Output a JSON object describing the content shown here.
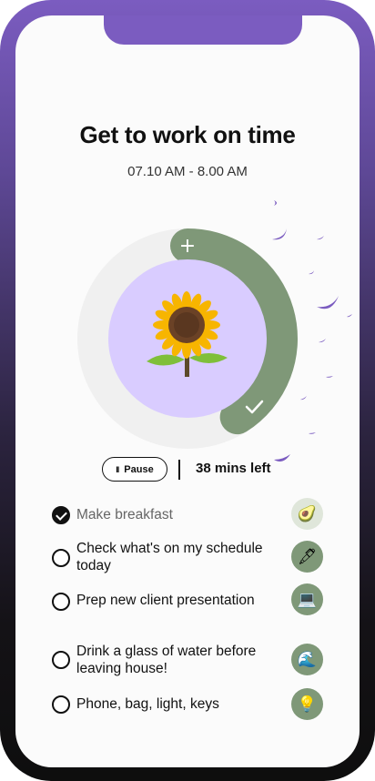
{
  "header": {
    "title": "Get to work on time",
    "time_range": "07.10 AM - 8.00 AM"
  },
  "dial": {
    "add_glyph": "+",
    "done_glyph": "✓",
    "center_icon": "sunflower-icon",
    "progress_fraction": 0.41
  },
  "controls": {
    "pause_icon": "II",
    "pause_label": "Pause",
    "time_left": "38 mins left"
  },
  "tasks": [
    {
      "label": "Make breakfast",
      "done": true,
      "icon": "avocado-icon",
      "glyph": "🥑"
    },
    {
      "label": "Check what's on my schedule today",
      "done": false,
      "icon": "pen-icon",
      "glyph": "🖋"
    },
    {
      "label": "Prep new client presentation",
      "done": false,
      "icon": "laptop-icon",
      "glyph": "💻"
    },
    {
      "label": "Drink a glass of water before leaving house!",
      "done": false,
      "icon": "water-wave-icon",
      "glyph": "🌊"
    },
    {
      "label": "Phone, bag, light, keys",
      "done": false,
      "icon": "light-bulb-icon",
      "glyph": "💡"
    }
  ],
  "colors": {
    "accent_purple": "#7b5cc0",
    "progress_green": "#7f9878",
    "center_lavender": "#d9ccff",
    "track_gray": "#f0f0f0"
  }
}
